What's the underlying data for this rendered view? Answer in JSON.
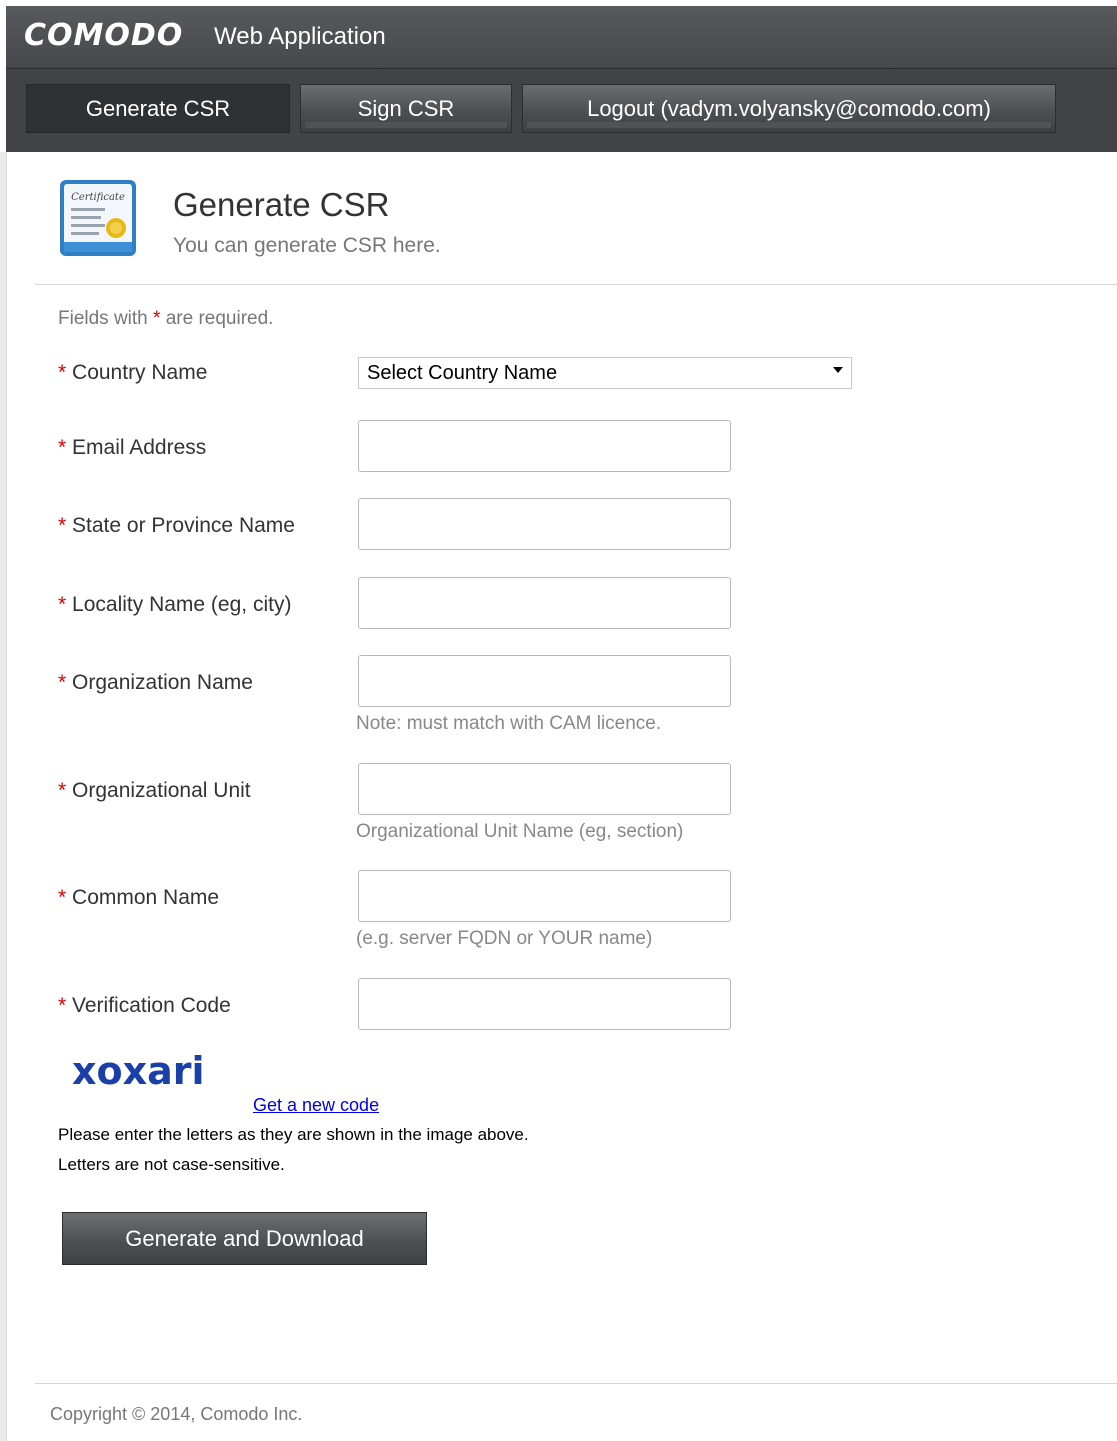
{
  "app": {
    "brand": "COMODO",
    "subtitle": "Web Application"
  },
  "nav": {
    "generate_csr": "Generate CSR",
    "sign_csr": "Sign CSR",
    "logout": "Logout (vadym.volyansky@comodo.com)"
  },
  "page": {
    "title": "Generate CSR",
    "subtitle": "You can generate CSR here.",
    "icon": "certificate-icon"
  },
  "form": {
    "required_note_prefix": "Fields with ",
    "required_star": "*",
    "required_note_suffix": " are required.",
    "country": {
      "label": "Country Name",
      "selected": "Select Country Name"
    },
    "email": {
      "label": "Email Address",
      "value": ""
    },
    "state": {
      "label": "State or Province Name",
      "value": ""
    },
    "locality": {
      "label": "Locality Name (eg, city)",
      "value": ""
    },
    "organization": {
      "label": "Organization Name",
      "value": "",
      "hint": "Note: must match with CAM licence."
    },
    "org_unit": {
      "label": "Organizational Unit",
      "value": "",
      "hint": "Organizational Unit Name (eg, section)"
    },
    "common_name": {
      "label": "Common Name",
      "value": "",
      "hint": "(e.g. server FQDN or YOUR name)"
    },
    "verification": {
      "label": "Verification Code",
      "value": ""
    },
    "captcha_text": "xoxari",
    "new_code_link": "Get a new code",
    "info_line1": "Please enter the letters as they are shown in the image above.",
    "info_line2": "Letters are not case-sensitive.",
    "submit": "Generate and Download"
  },
  "footer": {
    "copyright": "Copyright © 2014, Comodo Inc."
  },
  "colors": {
    "header_dark": "#3a3c40",
    "required_red": "#dd0000",
    "link_blue": "#0000ee",
    "captcha_blue": "#1a3fa8"
  }
}
